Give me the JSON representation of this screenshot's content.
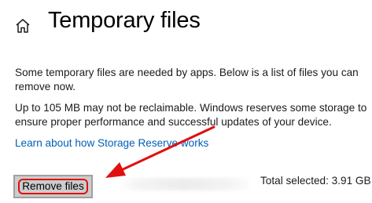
{
  "header": {
    "title": "Temporary files",
    "home_icon": "home-icon"
  },
  "main": {
    "description": "Some temporary files are needed by apps. Below is a list of files you can remove now.",
    "reserve_note": "Up to 105 MB may not be reclaimable. Windows reserves some storage to ensure proper performance and successful updates of your device.",
    "learn_link": "Learn about how Storage Reserve works"
  },
  "actions": {
    "remove_label": "Remove files",
    "total_selected": "Total selected: 3.91 GB"
  },
  "colors": {
    "link": "#005fb8",
    "highlight": "#e01010",
    "button_bg": "#cccccc"
  }
}
